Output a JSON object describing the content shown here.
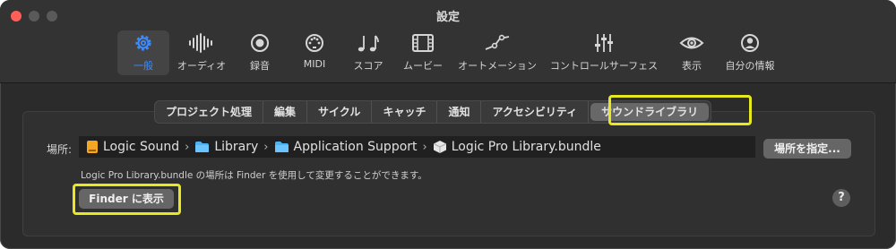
{
  "window": {
    "title": "設定"
  },
  "toolbar": {
    "items": [
      {
        "label": "一般",
        "icon": "gear-icon",
        "active": true
      },
      {
        "label": "オーディオ",
        "icon": "waveform-icon"
      },
      {
        "label": "録音",
        "icon": "record-icon"
      },
      {
        "label": "MIDI",
        "icon": "midi-port-icon"
      },
      {
        "label": "スコア",
        "icon": "music-notes-icon"
      },
      {
        "label": "ムービー",
        "icon": "film-icon"
      },
      {
        "label": "オートメーション",
        "icon": "automation-curve-icon"
      },
      {
        "label": "コントロールサーフェス",
        "icon": "faders-icon"
      },
      {
        "label": "表示",
        "icon": "eye-icon"
      },
      {
        "label": "自分の情報",
        "icon": "person-icon"
      }
    ],
    "active_color": "#3d8bff"
  },
  "tabs": [
    {
      "label": "プロジェクト処理"
    },
    {
      "label": "編集"
    },
    {
      "label": "サイクル"
    },
    {
      "label": "キャッチ"
    },
    {
      "label": "通知"
    },
    {
      "label": "アクセシビリティ"
    },
    {
      "label": "サウンドライブラリ",
      "selected": true
    }
  ],
  "location": {
    "label": "場所:",
    "path": [
      {
        "name": "Logic Sound",
        "icon": "drive-icon"
      },
      {
        "name": "Library",
        "icon": "folder-icon"
      },
      {
        "name": "Application Support",
        "icon": "folder-icon"
      },
      {
        "name": "Logic Pro Library.bundle",
        "icon": "bundle-icon"
      }
    ],
    "set_button": "場所を指定...",
    "description": "Logic Pro Library.bundle の場所は Finder を使用して変更することができます。",
    "finder_button": "Finder に表示"
  },
  "help": {
    "label": "?"
  },
  "highlight_color": "#e8e820"
}
